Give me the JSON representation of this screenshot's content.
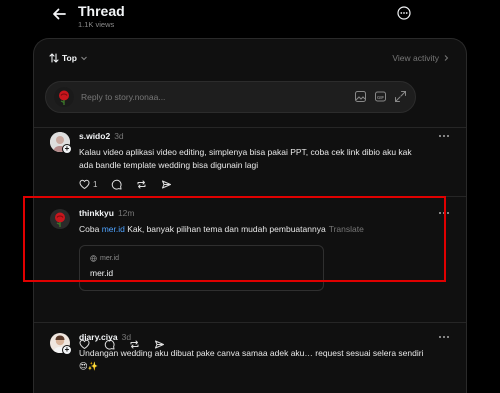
{
  "header": {
    "title": "Thread",
    "views": "1.1K views"
  },
  "sort": {
    "label": "Top",
    "view_activity": "View activity"
  },
  "reply": {
    "placeholder": "Reply to story.nonaa..."
  },
  "posts": [
    {
      "username": "s.wido2",
      "time": "3d",
      "text": "Kalau video aplikasi video editing, simplenya bisa pakai PPT, coba cek link dibio aku kak ada bandle template wedding bisa digunain lagi",
      "like_count": "1"
    },
    {
      "username": "thinkkyu",
      "time": "12m",
      "text_before": "Coba ",
      "link_text": "mer.id",
      "text_after": " Kak, banyak pilihan tema dan mudah pembuatannya",
      "translate": "Translate",
      "card": {
        "domain": "mer.id",
        "title": "mer.id"
      }
    },
    {
      "username": "diary.ciya",
      "time": "3d",
      "text": "Undangan wedding aku dibuat pake canva samaa adek aku… request sesuai selera sendiri 😍✨"
    }
  ],
  "colors": {
    "link": "#4fa3ff",
    "highlight": "#e00000",
    "background": "#101010"
  }
}
